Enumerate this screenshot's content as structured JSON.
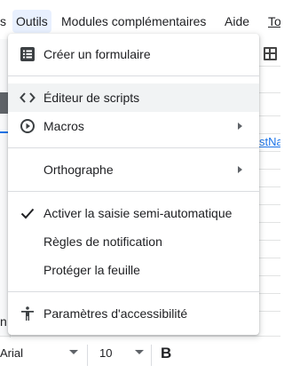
{
  "menubar": {
    "prev_tail": "s",
    "outils": "Outils",
    "modules": "Modules complémentaires",
    "aide": "Aide",
    "next_tail": "To"
  },
  "sheet": {
    "link_fragment": "stNa",
    "left_fragment": "n"
  },
  "toolbar": {
    "font": "Arial",
    "font_size": "10",
    "bold": "B"
  },
  "menu": {
    "items": [
      {
        "label": "Créer un formulaire",
        "icon": "form-icon"
      },
      {
        "label": "Éditeur de scripts",
        "icon": "code-icon"
      },
      {
        "label": "Macros",
        "icon": "play-circle-icon",
        "submenu": true
      },
      {
        "label": "Orthographe",
        "submenu": true
      },
      {
        "label": "Activer la saisie semi-automatique",
        "icon": "check-icon",
        "checked": true
      },
      {
        "label": "Règles de notification"
      },
      {
        "label": "Protéger la feuille"
      },
      {
        "label": "Paramètres d'accessibilité",
        "icon": "accessibility-icon"
      }
    ]
  }
}
